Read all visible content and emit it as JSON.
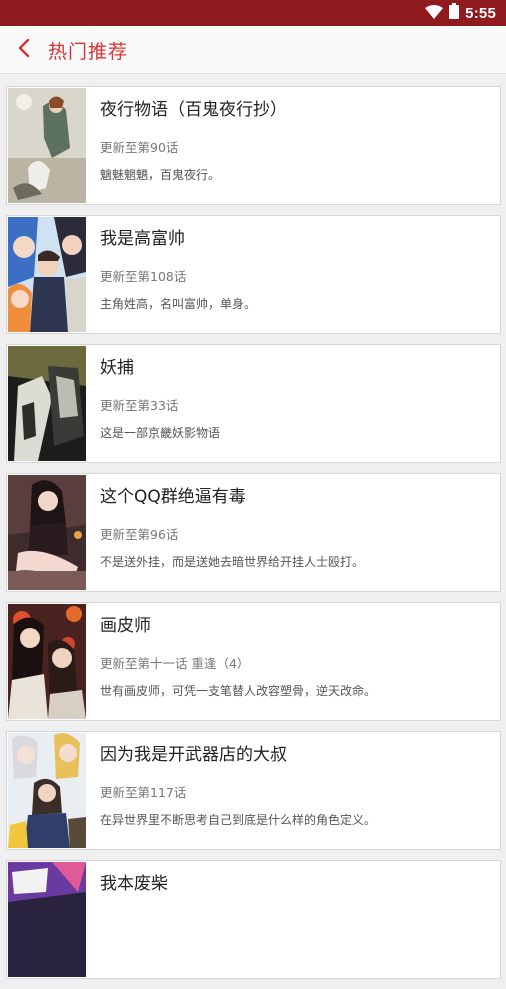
{
  "status_bar": {
    "time": "5:55",
    "icons": [
      "wifi-icon",
      "battery-icon"
    ]
  },
  "app_bar": {
    "title": "热门推荐",
    "back_icon": "chevron-left-icon",
    "accent": "#e03131"
  },
  "items": [
    {
      "title": "夜行物语（百鬼夜行抄）",
      "update": "更新至第90话",
      "desc": "魑魅魍魉，百鬼夜行。"
    },
    {
      "title": "我是高富帅",
      "update": "更新至第108话",
      "desc": "主角姓高，名叫富帅，单身。"
    },
    {
      "title": "妖捕",
      "update": "更新至第33话",
      "desc": "这是一部京畿妖影物语"
    },
    {
      "title": "这个QQ群绝逼有毒",
      "update": "更新至第96话",
      "desc": "不是送外挂，而是送她去暗世界给开挂人士殴打。"
    },
    {
      "title": "画皮师",
      "update": "更新至第十一话 重逢（4）",
      "desc": "世有画皮师，可凭一支笔替人改容塑骨，逆天改命。"
    },
    {
      "title": "因为我是开武器店的大叔",
      "update": "更新至第117话",
      "desc": "在异世界里不断思考自己到底是什么样的角色定义。"
    },
    {
      "title": "我本废柴",
      "update": "",
      "desc": ""
    }
  ]
}
